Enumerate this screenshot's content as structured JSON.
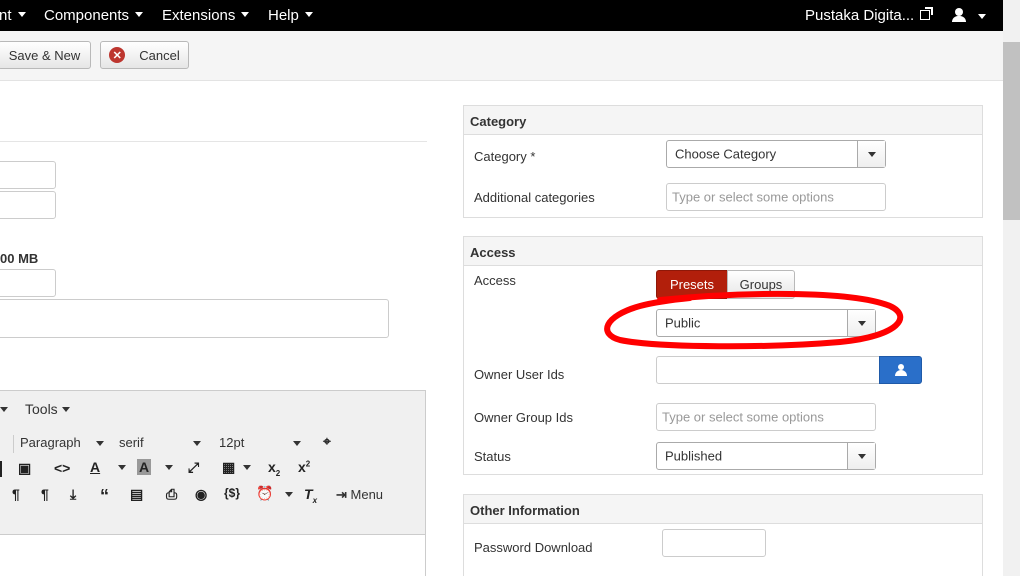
{
  "nav": {
    "items": [
      "nt",
      "Components",
      "Extensions",
      "Help"
    ],
    "site_link": "Pustaka Digita..."
  },
  "toolbar": {
    "save_new_label": "Save & New",
    "cancel_label": "Cancel"
  },
  "left": {
    "file_size_label": "00 MB"
  },
  "editor": {
    "tools_menu": "Tools",
    "block_format": "Paragraph",
    "font_family": "serif",
    "font_size": "12pt",
    "menu_label": "Menu"
  },
  "category": {
    "title": "Category",
    "category_label": "Category *",
    "category_value": "Choose Category",
    "additional_label": "Additional categories",
    "additional_placeholder": "Type or select some options"
  },
  "access": {
    "title": "Access",
    "access_label": "Access",
    "presets_label": "Presets",
    "groups_label": "Groups",
    "access_value": "Public",
    "owner_user_label": "Owner User Ids",
    "owner_group_label": "Owner Group Ids",
    "owner_group_placeholder": "Type or select some options",
    "status_label": "Status",
    "status_value": "Published"
  },
  "other": {
    "title": "Other Information",
    "password_label": "Password Download"
  },
  "colors": {
    "presets_active": "#b21f0b",
    "user_button": "#2a6fc9",
    "annotation": "#ff0000"
  }
}
